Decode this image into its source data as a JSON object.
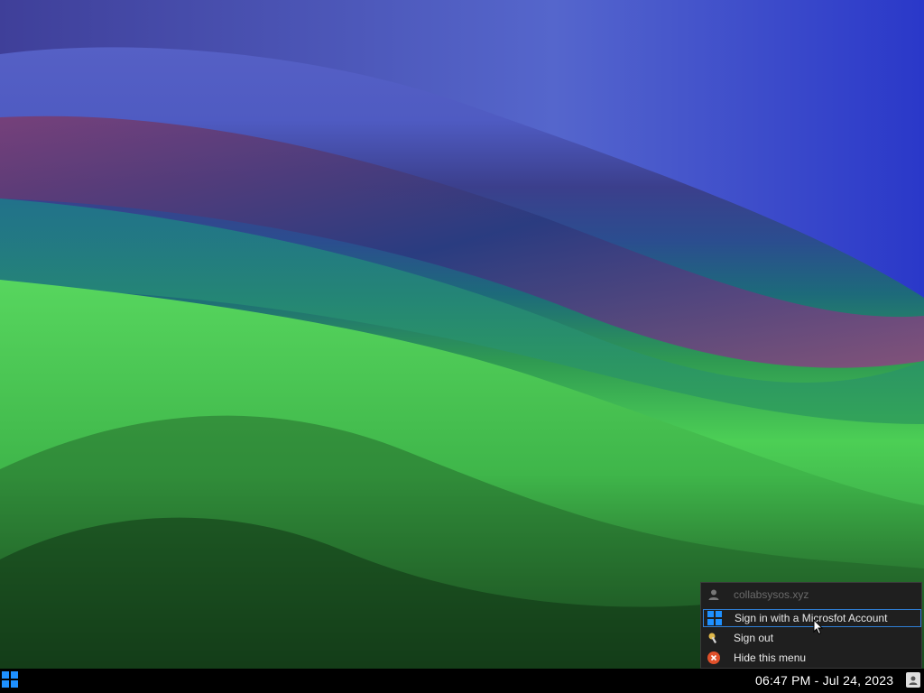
{
  "menu": {
    "items": [
      {
        "label": "collabsysos.xyz",
        "icon": "user-icon",
        "enabled": false
      },
      {
        "label": "Sign in with a Microsfot Account",
        "icon": "windows-logo-icon",
        "enabled": true,
        "selected": true
      },
      {
        "label": "Sign out",
        "icon": "key-icon",
        "enabled": true
      },
      {
        "label": "Hide this menu",
        "icon": "close-circle-icon",
        "enabled": true
      }
    ]
  },
  "taskbar": {
    "clock": "06:47 PM - Jul 24, 2023",
    "start_icon": "windows-logo-icon",
    "tray_icon": "user-icon"
  },
  "colors": {
    "accent": "#2f7fd6",
    "menu_bg": "#1f1f1f",
    "close_red": "#e0502a"
  }
}
